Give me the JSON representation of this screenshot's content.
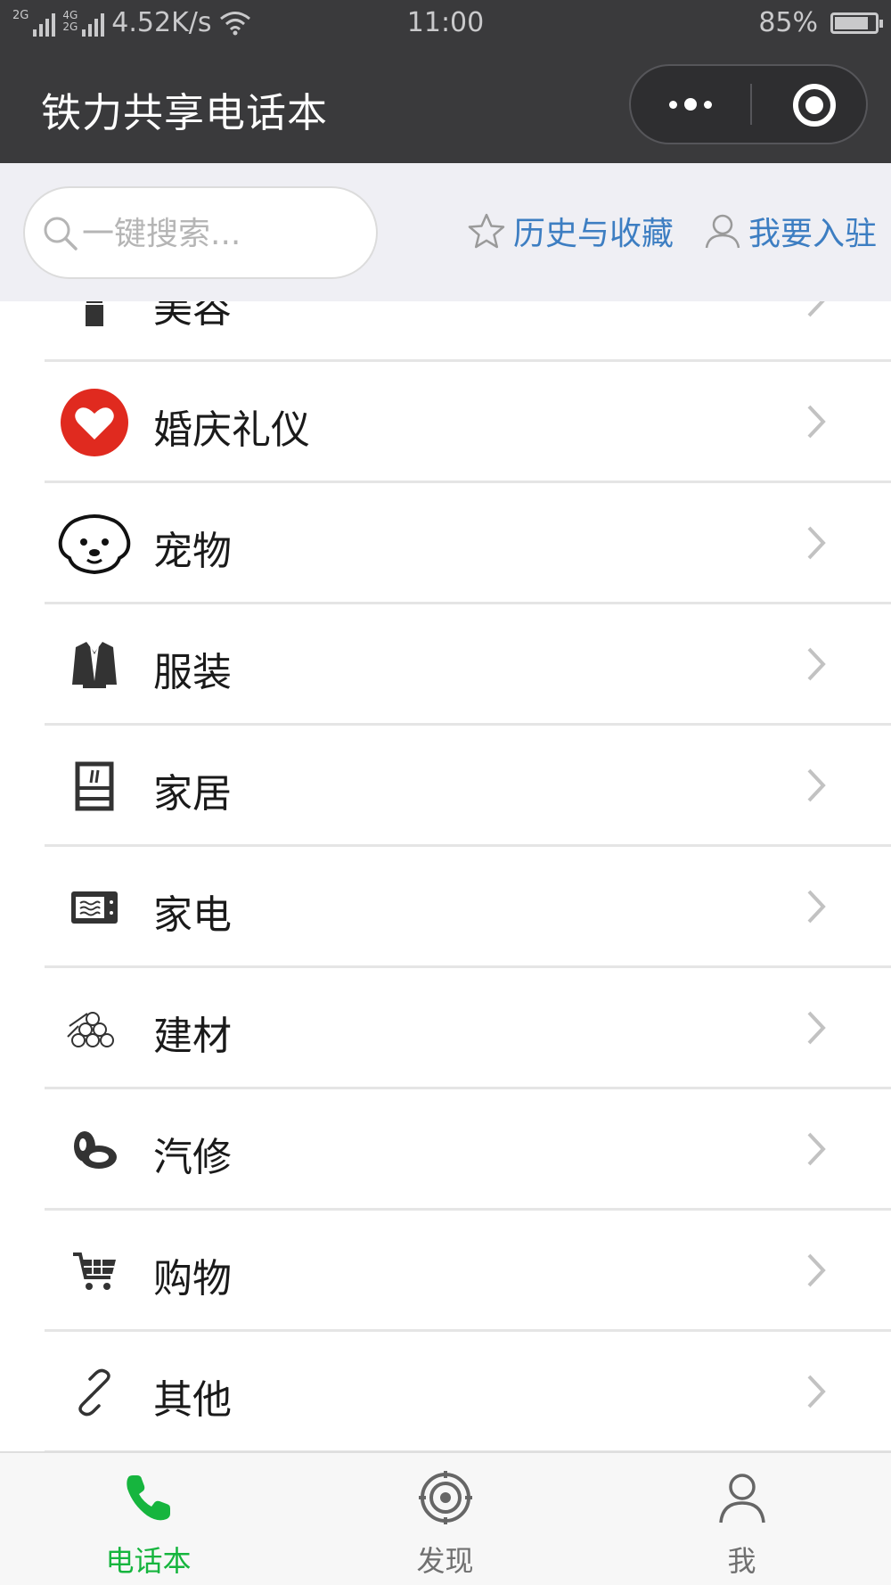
{
  "status_bar": {
    "net1": "2G",
    "net2": "4G",
    "net3": "2G",
    "speed": "4.52K/s",
    "time": "11:00",
    "battery": "85%",
    "battery_level": 0.85
  },
  "nav": {
    "title": "铁力共享电话本",
    "more_icon": "more-dots-icon",
    "close_icon": "target-close-icon"
  },
  "search": {
    "placeholder": "一键搜索...",
    "value": ""
  },
  "links": {
    "history": "历史与收藏",
    "join": "我要入驻"
  },
  "categories": [
    {
      "label": "美容",
      "icon": "lipstick-icon"
    },
    {
      "label": "婚庆礼仪",
      "icon": "heart-icon"
    },
    {
      "label": "宠物",
      "icon": "dog-icon"
    },
    {
      "label": "服装",
      "icon": "suit-icon"
    },
    {
      "label": "家居",
      "icon": "cabinet-icon"
    },
    {
      "label": "家电",
      "icon": "microwave-icon"
    },
    {
      "label": "建材",
      "icon": "pipes-icon"
    },
    {
      "label": "汽修",
      "icon": "tire-icon"
    },
    {
      "label": "购物",
      "icon": "cart-icon"
    },
    {
      "label": "其他",
      "icon": "link-icon"
    }
  ],
  "tabs": [
    {
      "label": "电话本",
      "icon": "phone-icon",
      "active": true
    },
    {
      "label": "发现",
      "icon": "compass-target-icon",
      "active": false
    },
    {
      "label": "我",
      "icon": "person-icon",
      "active": false
    }
  ],
  "colors": {
    "header": "#3a3a3c",
    "link": "#3d7ec2",
    "active_tab": "#16b53e",
    "heart": "#e02a1f"
  }
}
